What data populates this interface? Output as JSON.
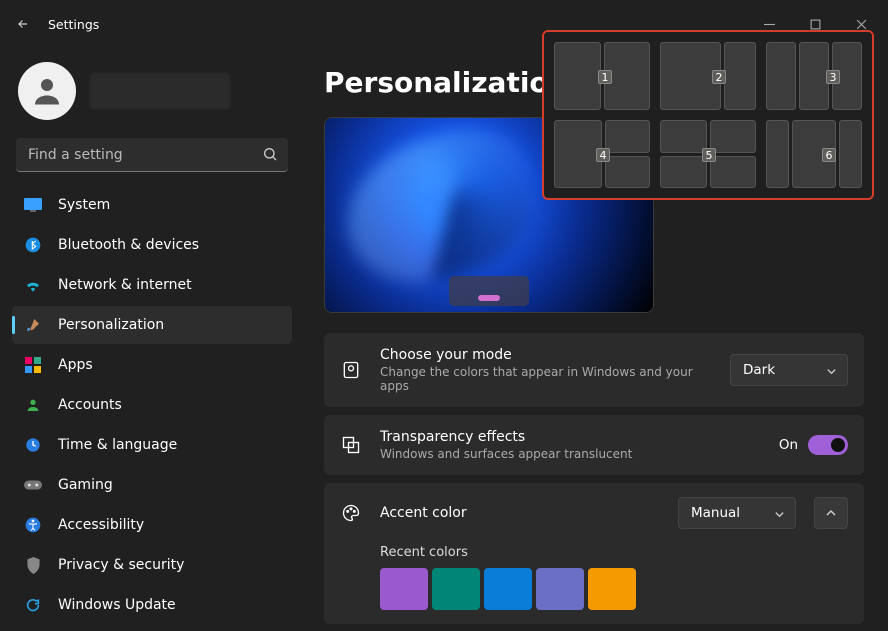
{
  "titlebar": {
    "title": "Settings"
  },
  "search": {
    "placeholder": "Find a setting"
  },
  "nav": {
    "items": [
      {
        "label": "System"
      },
      {
        "label": "Bluetooth & devices"
      },
      {
        "label": "Network & internet"
      },
      {
        "label": "Personalization"
      },
      {
        "label": "Apps"
      },
      {
        "label": "Accounts"
      },
      {
        "label": "Time & language"
      },
      {
        "label": "Gaming"
      },
      {
        "label": "Accessibility"
      },
      {
        "label": "Privacy & security"
      },
      {
        "label": "Windows Update"
      }
    ]
  },
  "page": {
    "heading": "Personalization",
    "mode": {
      "title": "Choose your mode",
      "sub": "Change the colors that appear in Windows and your apps",
      "value": "Dark"
    },
    "transparency": {
      "title": "Transparency effects",
      "sub": "Windows and surfaces appear translucent",
      "state_label": "On"
    },
    "accent": {
      "title": "Accent color",
      "value": "Manual",
      "recent_label": "Recent colors",
      "recent": [
        "#9b59d0",
        "#008577",
        "#0a7dd8",
        "#6b6fc5",
        "#f39b00"
      ]
    }
  },
  "snap": {
    "options": [
      "1",
      "2",
      "3",
      "4",
      "5",
      "6"
    ]
  }
}
